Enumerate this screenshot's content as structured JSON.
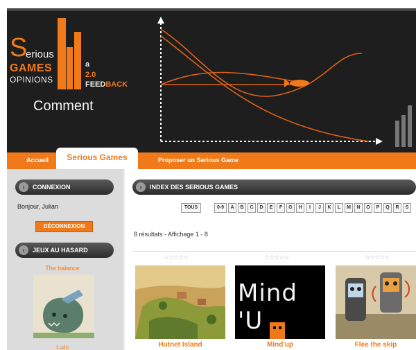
{
  "banner": {
    "logo_S": "S",
    "logo_erious": "erious",
    "logo_games": "GAMES",
    "logo_opinions": "OPINIONS",
    "logo_a": "a",
    "logo_20": "2.0",
    "logo_feed": "FEED",
    "logo_back": "BACK",
    "comment": "Comment",
    "accent": "#f07a1a"
  },
  "nav": {
    "home": "Accueil",
    "serious_games": "Serious Games",
    "propose": "Proposer un Serious Game"
  },
  "sidebar": {
    "connexion_title": "CONNEXION",
    "greeting": "Bonjour, Julian",
    "logout": "DÉCONNEXION",
    "random_title": "JEUX AU HASARD",
    "random_game": "The balance",
    "random_bottom": "Ludo"
  },
  "main": {
    "index_title": "INDEX DES SERIOUS GAMES",
    "all_button": "TOUS",
    "letters": [
      "0-9",
      "A",
      "B",
      "C",
      "D",
      "E",
      "F",
      "G",
      "H",
      "I",
      "J",
      "K",
      "L",
      "M",
      "N",
      "O",
      "P",
      "Q",
      "R",
      "S"
    ],
    "results": "8 résultats - Affichage 1 - 8",
    "stars": "☆☆☆☆☆",
    "games": [
      {
        "title": "Hutnet Island",
        "icon": "island-game-thumbnail"
      },
      {
        "title": "Mind'up",
        "icon": "mindup-game-thumbnail",
        "thumb_text": "Mind 'U"
      },
      {
        "title": "Flee the skip",
        "icon": "phone-characters-thumbnail"
      }
    ]
  }
}
